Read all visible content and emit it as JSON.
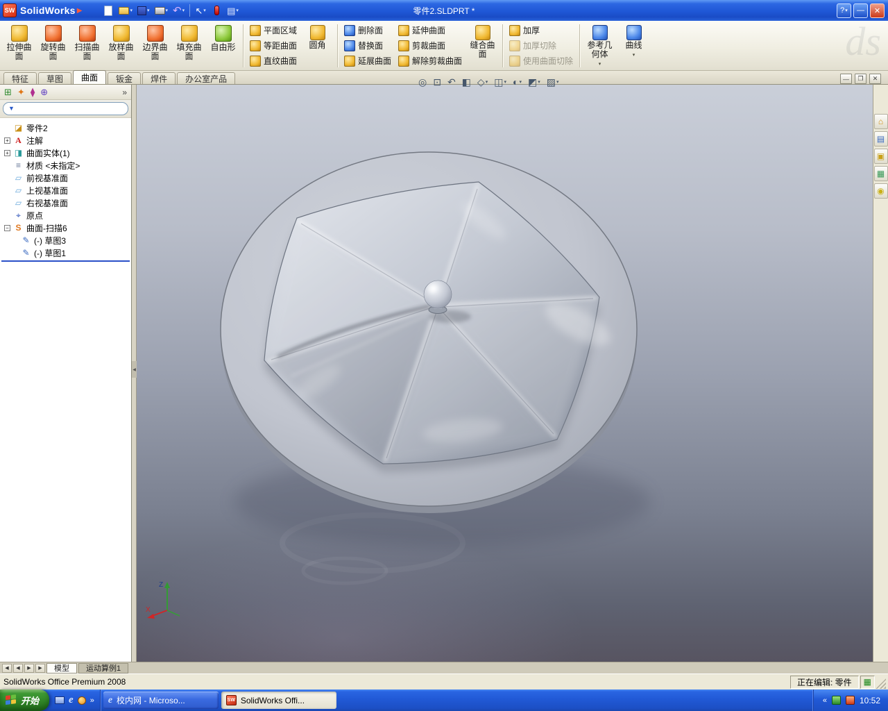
{
  "icons": {
    "dropdown_arrow": "▾",
    "overflow_chevron": "»",
    "sw_logo_text": "SW",
    "app_arrow": "▶",
    "undo_glyph": "↶",
    "select_glyph": "↖",
    "options_glyph": "▤",
    "funnel_glyph": "▼",
    "splitter_arrow": "◀",
    "watermark": "ds"
  },
  "titlebar": {
    "app_name": "SolidWorks",
    "doc_title": "零件2.SLDPRT *",
    "help_label": "?",
    "minimize_label": "—",
    "close_label": "✕"
  },
  "doc_window": {
    "minimize": "—",
    "restore": "❐",
    "close": "✕"
  },
  "command_tabs": {
    "items": [
      "特征",
      "草图",
      "曲面",
      "钣金",
      "焊件",
      "办公室产品"
    ],
    "active": "曲面"
  },
  "ribbon": {
    "large": [
      {
        "label": "拉伸曲面",
        "icon": "extruded-surface-icon"
      },
      {
        "label": "旋转曲面",
        "icon": "revolved-surface-icon"
      },
      {
        "label": "扫描曲面",
        "icon": "swept-surface-icon"
      },
      {
        "label": "放样曲面",
        "icon": "lofted-surface-icon"
      },
      {
        "label": "边界曲面",
        "icon": "boundary-surface-icon"
      },
      {
        "label": "填充曲面",
        "icon": "filled-surface-icon"
      },
      {
        "label": "自由形",
        "icon": "freeform-icon"
      }
    ],
    "group1": [
      "平面区域",
      "等距曲面",
      "直纹曲面"
    ],
    "fillet_label": "圆角",
    "group2": [
      "删除面",
      "替换面",
      "延展曲面"
    ],
    "group3": [
      "延伸曲面",
      "剪裁曲面",
      "解除剪裁曲面"
    ],
    "knit_label": "缝合曲面",
    "group4": [
      {
        "label": "加厚",
        "disabled": false
      },
      {
        "label": "加厚切除",
        "disabled": true
      },
      {
        "label": "使用曲面切除",
        "disabled": true
      }
    ],
    "ref_geometry_label": "参考几何体",
    "curves_label": "曲线"
  },
  "feature_tree": {
    "items": [
      {
        "label": "零件2",
        "expander": "",
        "icon": "part-icon",
        "glyph": "◪"
      },
      {
        "label": "注解",
        "expander": "+",
        "icon": "annotations-folder-icon",
        "glyph": "A"
      },
      {
        "label": "曲面实体(1)",
        "expander": "+",
        "icon": "surface-bodies-folder-icon",
        "glyph": "◨"
      },
      {
        "label": "材质 <未指定>",
        "expander": "",
        "icon": "material-icon",
        "glyph": "≡"
      },
      {
        "label": "前视基准面",
        "expander": "",
        "icon": "plane-icon",
        "glyph": "▱"
      },
      {
        "label": "上视基准面",
        "expander": "",
        "icon": "plane-icon",
        "glyph": "▱"
      },
      {
        "label": "右视基准面",
        "expander": "",
        "icon": "plane-icon",
        "glyph": "▱"
      },
      {
        "label": "原点",
        "expander": "",
        "icon": "origin-icon",
        "glyph": "⌖"
      },
      {
        "label": "曲面-扫描6",
        "expander": "−",
        "icon": "surface-sweep-icon",
        "glyph": "S"
      },
      {
        "label": "(-) 草图3",
        "expander": "",
        "icon": "sketch-icon",
        "glyph": "✎"
      },
      {
        "label": "(-) 草图1",
        "expander": "",
        "icon": "sketch-icon",
        "glyph": "✎"
      }
    ]
  },
  "view_toolbar": {
    "buttons": [
      {
        "name": "zoom-to-fit",
        "glyph": "◎"
      },
      {
        "name": "zoom-to-area",
        "glyph": "⊡"
      },
      {
        "name": "previous-view",
        "glyph": "↶"
      },
      {
        "name": "section-view",
        "glyph": "◧"
      },
      {
        "name": "view-orientation",
        "glyph": "◇"
      },
      {
        "name": "display-style",
        "glyph": "◫"
      },
      {
        "name": "hide-show-items",
        "glyph": "◐"
      },
      {
        "name": "edit-appearance",
        "glyph": "◩"
      },
      {
        "name": "apply-scene",
        "glyph": "▨"
      }
    ]
  },
  "task_pane": {
    "buttons": [
      {
        "name": "solidworks-resources",
        "glyph": "⌂"
      },
      {
        "name": "design-library",
        "glyph": "▤"
      },
      {
        "name": "file-explorer",
        "glyph": "▣"
      },
      {
        "name": "view-palette",
        "glyph": "▦"
      },
      {
        "name": "appearances-scenes",
        "glyph": "◉"
      }
    ]
  },
  "triad": {
    "x_label": "X",
    "z_label": "Z"
  },
  "bottom_tabs": {
    "nav": [
      "◀",
      "◀",
      "▶",
      "▶"
    ],
    "model_label": "模型",
    "motion_label": "运动算例1"
  },
  "status_bar": {
    "product": "SolidWorks Office Premium 2008",
    "editing": "正在编辑: 零件"
  },
  "taskbar": {
    "start_label": "开始",
    "tasks": [
      {
        "label": "校内网 - Microso...",
        "icon": "internet-explorer-icon",
        "active": false
      },
      {
        "label": "SolidWorks Offi...",
        "icon": "solidworks-icon",
        "active": true
      }
    ],
    "tray_time": "10:52"
  }
}
